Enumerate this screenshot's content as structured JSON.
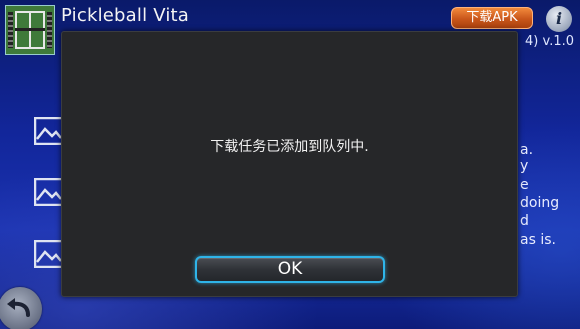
{
  "app": {
    "title": "Pickleball Vita",
    "version_fragment": "4) v.1.0"
  },
  "header": {
    "download_apk_label": "下载APK",
    "info_label": "i"
  },
  "description_fragments": [
    "a.",
    "y",
    "e",
    "doing",
    "d",
    "as is."
  ],
  "dialog": {
    "message": "下载任务已添加到队列中.",
    "ok_label": "OK"
  },
  "icons": {
    "app_icon": "pickleball-court-icon",
    "image_placeholder": "image-placeholder-icon",
    "back": "back-arrow-icon",
    "info": "info-icon"
  },
  "colors": {
    "download_button": "#d8631f",
    "ok_border": "#2fb4e8",
    "dialog_bg": "#262729",
    "background": "#12269a"
  }
}
